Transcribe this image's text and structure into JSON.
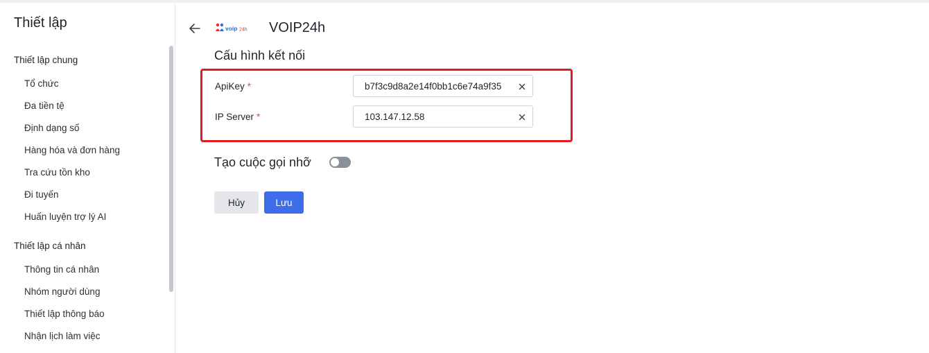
{
  "sidebar": {
    "title": "Thiết lập",
    "sections": [
      {
        "title": "Thiết lập chung",
        "items": [
          {
            "label": "Tổ chức"
          },
          {
            "label": "Đa tiền tệ"
          },
          {
            "label": "Định dạng số"
          },
          {
            "label": "Hàng hóa và đơn hàng"
          },
          {
            "label": "Tra cứu tồn kho"
          },
          {
            "label": "Đi tuyến"
          },
          {
            "label": "Huấn luyện trợ lý AI"
          }
        ]
      },
      {
        "title": "Thiết lập cá nhân",
        "items": [
          {
            "label": "Thông tin cá nhân"
          },
          {
            "label": "Nhóm người dùng"
          },
          {
            "label": "Thiết lập thông báo"
          },
          {
            "label": "Nhận lịch làm việc"
          }
        ]
      }
    ]
  },
  "header": {
    "logo_text": "voip24h",
    "title": "VOIP24h"
  },
  "config": {
    "heading": "Cấu hình kết nối",
    "required_mark": "*",
    "fields": [
      {
        "label": "ApiKey",
        "value": "b7f3c9d8a2e14f0bb1c6e74a9f35"
      },
      {
        "label": "IP Server",
        "value": "103.147.12.58"
      }
    ]
  },
  "missed_call": {
    "label": "Tạo cuộc gọi nhỡ",
    "enabled": false
  },
  "actions": {
    "cancel_label": "Hủy",
    "save_label": "Lưu"
  },
  "colors": {
    "primary": "#3d6de9",
    "highlight": "#e01b24",
    "required": "#e5484d"
  }
}
